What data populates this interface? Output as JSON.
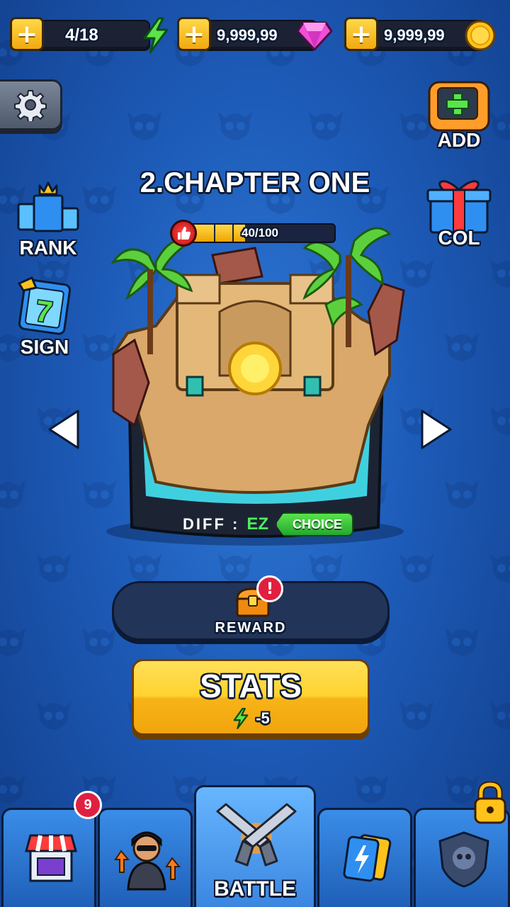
{
  "resources": {
    "energy": {
      "value": "4/18",
      "icon": "lightning-icon"
    },
    "gems": {
      "value": "9,999,99",
      "icon": "gem-icon"
    },
    "coins": {
      "value": "9,999,99",
      "icon": "coin-icon"
    },
    "plus_icon": "plus-icon"
  },
  "side_left": {
    "rank_label": "RANK",
    "sign_label": "SIGN",
    "sign_day": "7"
  },
  "side_right": {
    "add_label": "ADD",
    "col_label": "COL"
  },
  "chapter": {
    "title": "2.CHAPTER ONE",
    "progress_text": "40/100",
    "progress": 0.4,
    "difficulty_label": "DIFF :",
    "difficulty_value": "EZ",
    "choice_label": "CHOICE"
  },
  "reward": {
    "label": "REWARD",
    "alert": "!"
  },
  "stats_button": {
    "label": "STATS",
    "cost": "-5"
  },
  "nav": {
    "shop_badge": "9",
    "battle_label": "BATTLE"
  },
  "colors": {
    "background": "#1d5bb8",
    "accent_yellow": "#ffd22e",
    "alert_red": "#e02040",
    "diff_green": "#4cf05a"
  }
}
